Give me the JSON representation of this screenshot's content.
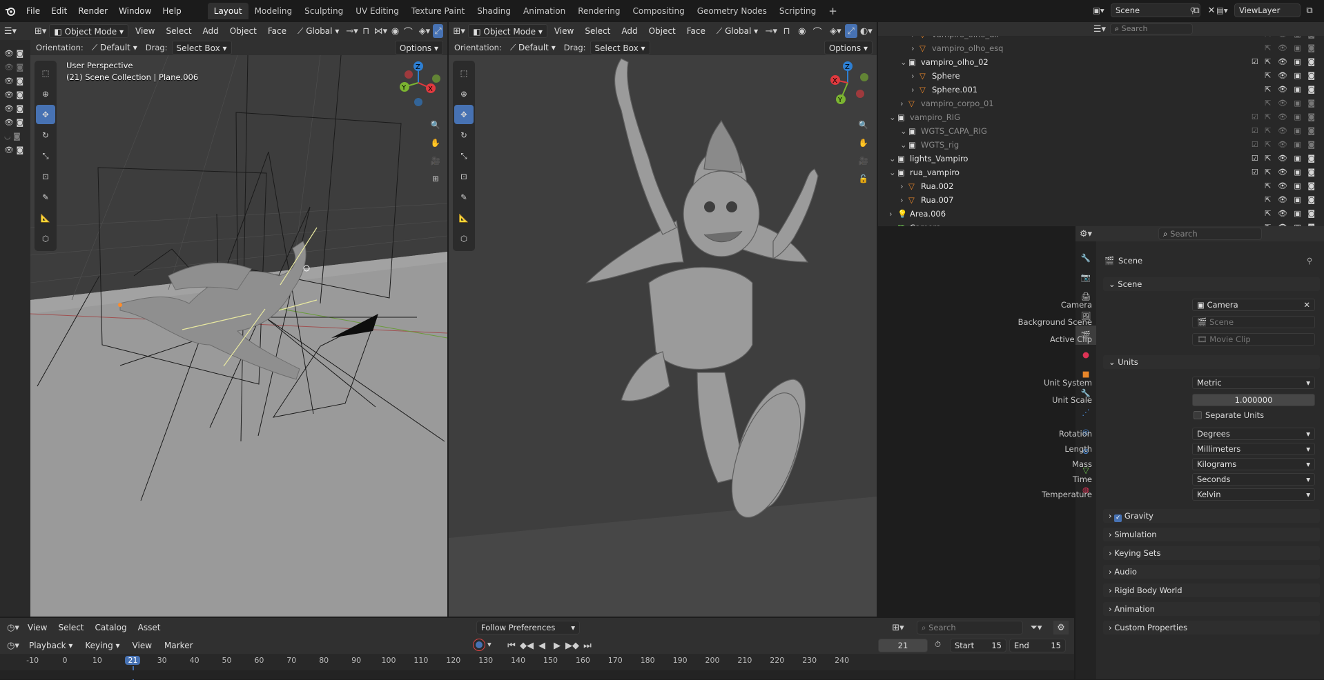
{
  "menus": [
    "File",
    "Edit",
    "Render",
    "Window",
    "Help"
  ],
  "workspaces": [
    "Layout",
    "Modeling",
    "Sculpting",
    "UV Editing",
    "Texture Paint",
    "Shading",
    "Animation",
    "Rendering",
    "Compositing",
    "Geometry Nodes",
    "Scripting"
  ],
  "active_workspace": "Layout",
  "scene_name": "Scene",
  "view_layer": "ViewLayer",
  "viewport_left": {
    "mode": "Object Mode",
    "menus": [
      "View",
      "Select",
      "Add",
      "Object",
      "Face"
    ],
    "transform": "Global",
    "orientation_label": "Orientation:",
    "orientation": "Default",
    "drag_label": "Drag:",
    "drag": "Select Box",
    "options": "Options",
    "overlay_title": "User Perspective",
    "overlay_sub": "(21) Scene Collection | Plane.006"
  },
  "viewport_right": {
    "mode": "Object Mode",
    "menus": [
      "View",
      "Select",
      "Add",
      "Object",
      "Face"
    ],
    "transform": "Global",
    "orientation_label": "Orientation:",
    "orientation": "Default",
    "drag_label": "Drag:",
    "drag": "Select Box",
    "options": "Options"
  },
  "gizmo": {
    "z": "Z",
    "y": "Y",
    "x": "X"
  },
  "outliner": {
    "search_placeholder": "Search",
    "rows": [
      {
        "name": "vampiro_olho_dir",
        "indent": 3,
        "kind": "obj",
        "dim": true
      },
      {
        "name": "vampiro_olho_esq",
        "indent": 3,
        "kind": "obj",
        "dim": true
      },
      {
        "name": "vampiro_olho_02",
        "indent": 2,
        "kind": "coll",
        "dim": false
      },
      {
        "name": "Sphere",
        "indent": 3,
        "kind": "obj",
        "dim": false
      },
      {
        "name": "Sphere.001",
        "indent": 3,
        "kind": "obj",
        "dim": false
      },
      {
        "name": "vampiro_corpo_01",
        "indent": 2,
        "kind": "obj",
        "dim": true
      },
      {
        "name": "vampiro_RIG",
        "indent": 1,
        "kind": "coll",
        "dim": true
      },
      {
        "name": "WGTS_CAPA_RIG",
        "indent": 2,
        "kind": "coll",
        "dim": true
      },
      {
        "name": "WGTS_rig",
        "indent": 2,
        "kind": "coll",
        "dim": true
      },
      {
        "name": "lights_Vampiro",
        "indent": 1,
        "kind": "coll",
        "dim": false
      },
      {
        "name": "rua_vampiro",
        "indent": 1,
        "kind": "coll",
        "dim": false
      },
      {
        "name": "Rua.002",
        "indent": 2,
        "kind": "obj",
        "dim": false
      },
      {
        "name": "Rua.007",
        "indent": 2,
        "kind": "obj",
        "dim": false
      },
      {
        "name": "Area.006",
        "indent": 1,
        "kind": "light",
        "dim": false
      },
      {
        "name": "Camera",
        "indent": 1,
        "kind": "cam",
        "dim": false
      }
    ]
  },
  "properties": {
    "search_placeholder": "Search",
    "breadcrumb": "Scene",
    "scene_panel": "Scene",
    "camera_label": "Camera",
    "camera_value": "Camera",
    "bg_scene_label": "Background Scene",
    "bg_scene_placeholder": "Scene",
    "active_clip_label": "Active Clip",
    "active_clip_placeholder": "Movie Clip",
    "units_panel": "Units",
    "unit_system_label": "Unit System",
    "unit_system": "Metric",
    "unit_scale_label": "Unit Scale",
    "unit_scale": "1.000000",
    "separate_units": "Separate Units",
    "rotation_label": "Rotation",
    "rotation": "Degrees",
    "length_label": "Length",
    "length": "Millimeters",
    "mass_label": "Mass",
    "mass": "Kilograms",
    "time_label": "Time",
    "time": "Seconds",
    "temperature_label": "Temperature",
    "temperature": "Kelvin",
    "collapsed_panels": [
      "Gravity",
      "Simulation",
      "Keying Sets",
      "Audio",
      "Rigid Body World",
      "Animation",
      "Custom Properties"
    ]
  },
  "timeline": {
    "menus": [
      "View",
      "Select",
      "Catalog",
      "Asset"
    ],
    "follow": "Follow Preferences",
    "search_placeholder": "Search",
    "playback": "Playback",
    "keying": "Keying",
    "view": "View",
    "marker": "Marker",
    "current_frame": "21",
    "start_label": "Start",
    "start": "15",
    "end_label": "End",
    "end": "15",
    "ruler": [
      "-10",
      "0",
      "10",
      "21",
      "30",
      "40",
      "50",
      "60",
      "70",
      "80",
      "90",
      "100",
      "110",
      "120",
      "130",
      "140",
      "150",
      "160",
      "170",
      "180",
      "190",
      "200",
      "210",
      "220",
      "230",
      "240"
    ]
  },
  "colors": {
    "accent": "#4772b3",
    "bg": "#1d1d1d",
    "panel": "#303030",
    "viewport": "#3d3d3d",
    "gizmo_x": "#e0393e",
    "gizmo_y": "#7bb431",
    "gizmo_z": "#2d7fd3"
  }
}
